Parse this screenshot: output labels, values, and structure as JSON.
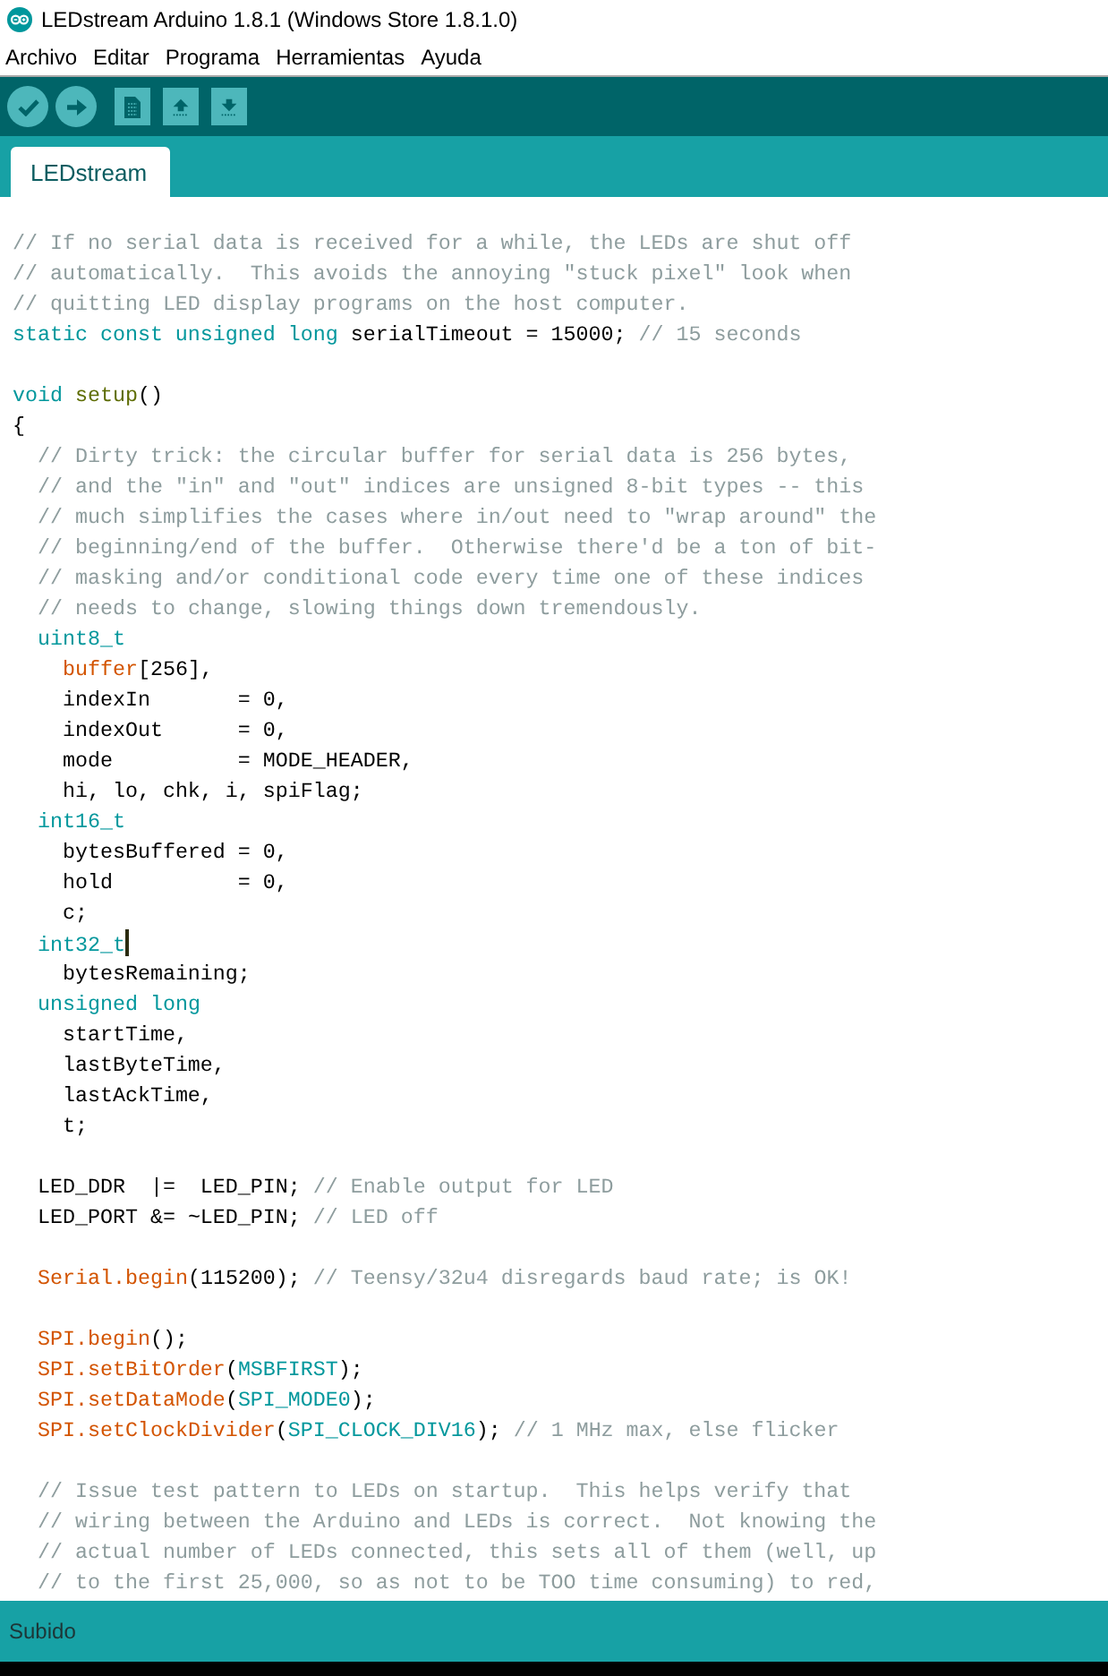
{
  "window": {
    "title": "LEDstream Arduino 1.8.1 (Windows Store 1.8.1.0)"
  },
  "menu": [
    "Archivo",
    "Editar",
    "Programa",
    "Herramientas",
    "Ayuda"
  ],
  "tabs": [
    {
      "label": "LEDstream",
      "selected": true
    }
  ],
  "editor": {
    "lines": [
      {
        "kind": "code",
        "caret": false,
        "tokens": [
          {
            "kind": "comment",
            "text": "// If no serial data is received for a while, the LEDs are shut off"
          }
        ]
      },
      {
        "kind": "code",
        "caret": false,
        "tokens": [
          {
            "kind": "comment",
            "text": "// automatically.  This avoids the annoying \"stuck pixel\" look when"
          }
        ]
      },
      {
        "kind": "code",
        "caret": false,
        "tokens": [
          {
            "kind": "comment",
            "text": "// quitting LED display programs on the host computer."
          }
        ]
      },
      {
        "kind": "code",
        "caret": false,
        "tokens": [
          {
            "kind": "keyword",
            "text": "static const unsigned long"
          },
          {
            "kind": "plain",
            "text": " serialTimeout = 15000; "
          },
          {
            "kind": "comment",
            "text": "// 15 seconds"
          }
        ]
      },
      {
        "kind": "blank",
        "caret": false
      },
      {
        "kind": "code",
        "caret": false,
        "tokens": [
          {
            "kind": "keyword",
            "text": "void"
          },
          {
            "kind": "builtin",
            "text": " setup"
          },
          {
            "kind": "plain",
            "text": "()"
          }
        ]
      },
      {
        "kind": "code",
        "caret": false,
        "tokens": [
          {
            "kind": "plain",
            "text": "{"
          }
        ]
      },
      {
        "kind": "code",
        "caret": false,
        "tokens": [
          {
            "kind": "comment",
            "text": "  // Dirty trick: the circular buffer for serial data is 256 bytes,"
          }
        ]
      },
      {
        "kind": "code",
        "caret": false,
        "tokens": [
          {
            "kind": "comment",
            "text": "  // and the \"in\" and \"out\" indices are unsigned 8-bit types -- this"
          }
        ]
      },
      {
        "kind": "code",
        "caret": false,
        "tokens": [
          {
            "kind": "comment",
            "text": "  // much simplifies the cases where in/out need to \"wrap around\" the"
          }
        ]
      },
      {
        "kind": "code",
        "caret": false,
        "tokens": [
          {
            "kind": "comment",
            "text": "  // beginning/end of the buffer.  Otherwise there'd be a ton of bit-"
          }
        ]
      },
      {
        "kind": "code",
        "caret": false,
        "tokens": [
          {
            "kind": "comment",
            "text": "  // masking and/or conditional code every time one of these indices"
          }
        ]
      },
      {
        "kind": "code",
        "caret": false,
        "tokens": [
          {
            "kind": "comment",
            "text": "  // needs to change, slowing things down tremendously."
          }
        ]
      },
      {
        "kind": "code",
        "caret": false,
        "tokens": [
          {
            "kind": "keyword",
            "text": "  uint8_t"
          }
        ]
      },
      {
        "kind": "code",
        "caret": false,
        "tokens": [
          {
            "kind": "function",
            "text": "    buffer"
          },
          {
            "kind": "plain",
            "text": "[256],"
          }
        ]
      },
      {
        "kind": "code",
        "caret": false,
        "tokens": [
          {
            "kind": "plain",
            "text": "    indexIn       = 0,"
          }
        ]
      },
      {
        "kind": "code",
        "caret": false,
        "tokens": [
          {
            "kind": "plain",
            "text": "    indexOut      = 0,"
          }
        ]
      },
      {
        "kind": "code",
        "caret": false,
        "tokens": [
          {
            "kind": "plain",
            "text": "    mode          = MODE_HEADER,"
          }
        ]
      },
      {
        "kind": "code",
        "caret": false,
        "tokens": [
          {
            "kind": "plain",
            "text": "    hi, lo, chk, i, spiFlag;"
          }
        ]
      },
      {
        "kind": "code",
        "caret": false,
        "tokens": [
          {
            "kind": "keyword",
            "text": "  int16_t"
          }
        ]
      },
      {
        "kind": "code",
        "caret": false,
        "tokens": [
          {
            "kind": "plain",
            "text": "    bytesBuffered = 0,"
          }
        ]
      },
      {
        "kind": "code",
        "caret": false,
        "tokens": [
          {
            "kind": "plain",
            "text": "    hold          = 0,"
          }
        ]
      },
      {
        "kind": "code",
        "caret": false,
        "tokens": [
          {
            "kind": "plain",
            "text": "    c;"
          }
        ]
      },
      {
        "kind": "code",
        "caret": true,
        "tokens": [
          {
            "kind": "keyword",
            "text": "  int32_t"
          }
        ]
      },
      {
        "kind": "code",
        "caret": false,
        "tokens": [
          {
            "kind": "plain",
            "text": "    bytesRemaining;"
          }
        ]
      },
      {
        "kind": "code",
        "caret": false,
        "tokens": [
          {
            "kind": "keyword",
            "text": "  unsigned long"
          }
        ]
      },
      {
        "kind": "code",
        "caret": false,
        "tokens": [
          {
            "kind": "plain",
            "text": "    startTime,"
          }
        ]
      },
      {
        "kind": "code",
        "caret": false,
        "tokens": [
          {
            "kind": "plain",
            "text": "    lastByteTime,"
          }
        ]
      },
      {
        "kind": "code",
        "caret": false,
        "tokens": [
          {
            "kind": "plain",
            "text": "    lastAckTime,"
          }
        ]
      },
      {
        "kind": "code",
        "caret": false,
        "tokens": [
          {
            "kind": "plain",
            "text": "    t;"
          }
        ]
      },
      {
        "kind": "blank",
        "caret": false
      },
      {
        "kind": "code",
        "caret": false,
        "tokens": [
          {
            "kind": "plain",
            "text": "  LED_DDR  |=  LED_PIN; "
          },
          {
            "kind": "comment",
            "text": "// Enable output for LED"
          }
        ]
      },
      {
        "kind": "code",
        "caret": false,
        "tokens": [
          {
            "kind": "plain",
            "text": "  LED_PORT &= ~LED_PIN; "
          },
          {
            "kind": "comment",
            "text": "// LED off"
          }
        ]
      },
      {
        "kind": "blank",
        "caret": false
      },
      {
        "kind": "code",
        "caret": false,
        "tokens": [
          {
            "kind": "function",
            "text": "  Serial.begin"
          },
          {
            "kind": "plain",
            "text": "(115200); "
          },
          {
            "kind": "comment",
            "text": "// Teensy/32u4 disregards baud rate; is OK!"
          }
        ]
      },
      {
        "kind": "blank",
        "caret": false
      },
      {
        "kind": "code",
        "caret": false,
        "tokens": [
          {
            "kind": "function",
            "text": "  SPI.begin"
          },
          {
            "kind": "plain",
            "text": "();"
          }
        ]
      },
      {
        "kind": "code",
        "caret": false,
        "tokens": [
          {
            "kind": "function",
            "text": "  SPI.setBitOrder"
          },
          {
            "kind": "plain",
            "text": "("
          },
          {
            "kind": "keyword",
            "text": "MSBFIRST"
          },
          {
            "kind": "plain",
            "text": ");"
          }
        ]
      },
      {
        "kind": "code",
        "caret": false,
        "tokens": [
          {
            "kind": "function",
            "text": "  SPI.setDataMode"
          },
          {
            "kind": "plain",
            "text": "("
          },
          {
            "kind": "keyword",
            "text": "SPI_MODE0"
          },
          {
            "kind": "plain",
            "text": ");"
          }
        ]
      },
      {
        "kind": "code",
        "caret": false,
        "tokens": [
          {
            "kind": "function",
            "text": "  SPI.setClockDivider"
          },
          {
            "kind": "plain",
            "text": "("
          },
          {
            "kind": "keyword",
            "text": "SPI_CLOCK_DIV16"
          },
          {
            "kind": "plain",
            "text": "); "
          },
          {
            "kind": "comment",
            "text": "// 1 MHz max, else flicker"
          }
        ]
      },
      {
        "kind": "blank",
        "caret": false
      },
      {
        "kind": "code",
        "caret": false,
        "tokens": [
          {
            "kind": "comment",
            "text": "  // Issue test pattern to LEDs on startup.  This helps verify that"
          }
        ]
      },
      {
        "kind": "code",
        "caret": false,
        "tokens": [
          {
            "kind": "comment",
            "text": "  // wiring between the Arduino and LEDs is correct.  Not knowing the"
          }
        ]
      },
      {
        "kind": "code",
        "caret": false,
        "tokens": [
          {
            "kind": "comment",
            "text": "  // actual number of LEDs connected, this sets all of them (well, up"
          }
        ]
      },
      {
        "kind": "code",
        "caret": false,
        "tokens": [
          {
            "kind": "comment",
            "text": "  // to the first 25,000, so as not to be TOO time consuming) to red,"
          }
        ]
      }
    ]
  },
  "status_bar": {
    "message": "Subido"
  }
}
